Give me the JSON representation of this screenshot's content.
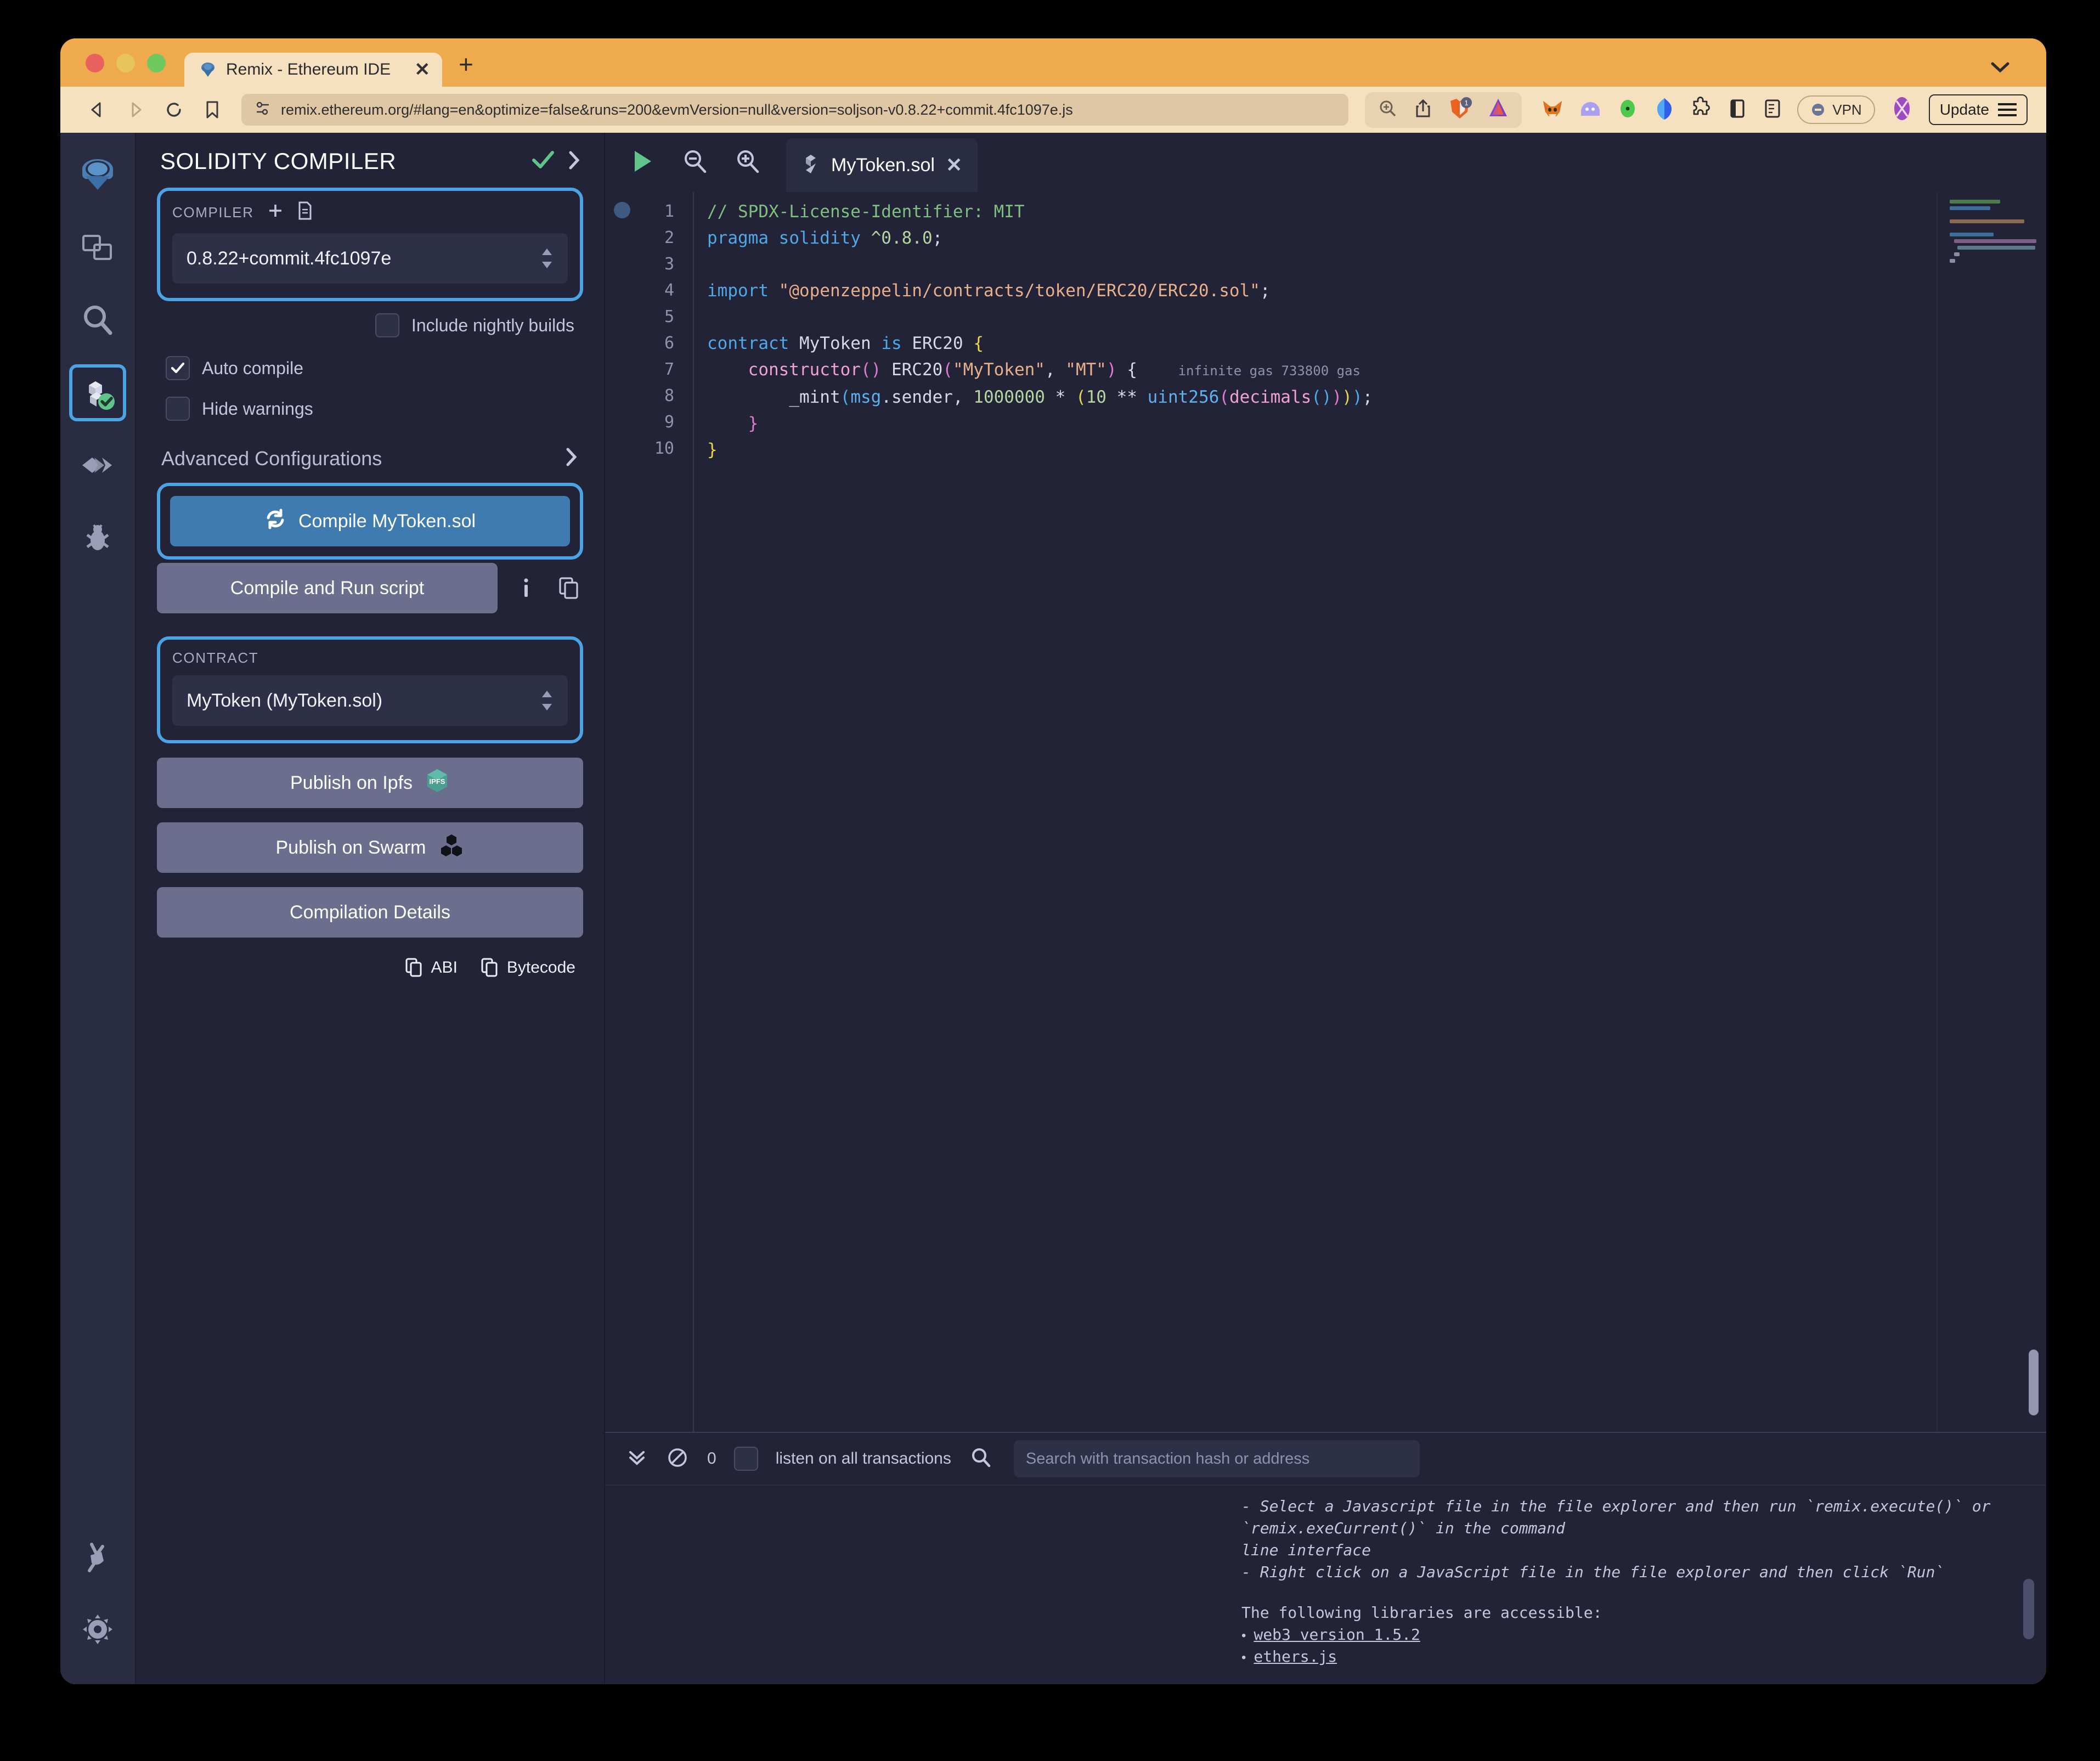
{
  "browser": {
    "tab_title": "Remix - Ethereum IDE",
    "tab_close": "✕",
    "new_tab": "+",
    "url": "remix.ethereum.org/#lang=en&optimize=false&runs=200&evmVersion=null&version=soljson-v0.8.22+commit.4fc1097e.js",
    "brave_shield_count": "1",
    "vpn_label": "VPN",
    "update_label": "Update"
  },
  "rail": {
    "items": [
      {
        "name": "remix-home",
        "label": "Home"
      },
      {
        "name": "file-explorer",
        "label": "File explorer"
      },
      {
        "name": "search",
        "label": "Search in files"
      },
      {
        "name": "solidity-compiler",
        "label": "Solidity compiler"
      },
      {
        "name": "deploy-run",
        "label": "Deploy & run transactions"
      },
      {
        "name": "debugger",
        "label": "Debugger"
      },
      {
        "name": "plugin-manager",
        "label": "Plugin manager"
      },
      {
        "name": "settings",
        "label": "Settings"
      }
    ]
  },
  "panel": {
    "title": "SOLIDITY COMPILER",
    "compiler_label": "COMPILER",
    "compiler_version": "0.8.22+commit.4fc1097e",
    "nightly_label": "Include nightly builds",
    "nightly_checked": false,
    "auto_compile_label": "Auto compile",
    "auto_compile_checked": true,
    "hide_warnings_label": "Hide warnings",
    "hide_warnings_checked": false,
    "advanced_label": "Advanced Configurations",
    "compile_button": "Compile MyToken.sol",
    "compile_run_button": "Compile and Run script",
    "contract_label": "CONTRACT",
    "contract_value": "MyToken (MyToken.sol)",
    "publish_ipfs": "Publish on Ipfs",
    "publish_swarm": "Publish on Swarm",
    "compilation_details": "Compilation Details",
    "abi_label": "ABI",
    "bytecode_label": "Bytecode"
  },
  "editor": {
    "tab_name": "MyToken.sol",
    "tab_close": "✕",
    "line_numbers": [
      "1",
      "2",
      "3",
      "4",
      "5",
      "6",
      "7",
      "8",
      "9",
      "10"
    ],
    "gas_annotation": "infinite gas 733800 gas",
    "code_lines": [
      "// SPDX-License-Identifier: MIT",
      "pragma solidity ^0.8.0;",
      "",
      "import \"@openzeppelin/contracts/token/ERC20/ERC20.sol\";",
      "",
      "contract MyToken is ERC20 {",
      "    constructor() ERC20(\"MyToken\", \"MT\") {",
      "        _mint(msg.sender, 1000000 * (10 ** uint256(decimals())));",
      "    }",
      "}"
    ]
  },
  "terminal": {
    "count": "0",
    "listen_label": "listen on all transactions",
    "listen_checked": false,
    "search_placeholder": "Search with transaction hash or address",
    "lines": [
      "  - Select a Javascript file in the file explorer and then run `remix.execute()` or `remix.exeCurrent()`  in the command",
      "line interface",
      "  - Right click on a JavaScript file in the file explorer and then click `Run`"
    ],
    "libraries_header": "The following libraries are accessible:",
    "libraries": [
      "web3 version 1.5.2",
      "ethers.js"
    ],
    "prompt": ">"
  },
  "colors": {
    "accent_highlight": "#4ba3e3",
    "primary_button": "#3f7bae",
    "muted_button": "#6b6e8d",
    "panel_bg": "#222336",
    "rail_bg": "#2a2c42",
    "browser_chrome": "#eeaa4d"
  }
}
